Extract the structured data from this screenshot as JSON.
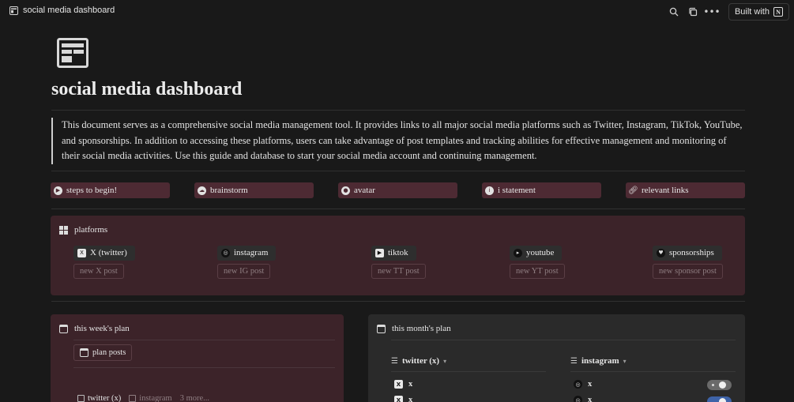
{
  "topbar": {
    "title": "social media dashboard",
    "built_label": "Built with",
    "icons": [
      "page-icon",
      "search-icon",
      "duplicate-icon",
      "more-icon"
    ]
  },
  "page": {
    "title": "social media dashboard",
    "description": "This document serves as a comprehensive social media management tool. It provides links to all major social media platforms such as Twitter, Instagram, TikTok, YouTube, and sponsorships. In addition to accessing these platforms, users can take advantage of post templates and tracking abilities for effective management and monitoring of their social media activities. Use this guide and database to start your social media account and continuing management."
  },
  "nav_buttons": [
    {
      "label": "steps to begin!",
      "icon": "play-icon"
    },
    {
      "label": "brainstorm",
      "icon": "brain-icon"
    },
    {
      "label": "avatar",
      "icon": "user-icon"
    },
    {
      "label": "i statement",
      "icon": "info-icon"
    },
    {
      "label": "relevant links",
      "icon": "link-icon"
    }
  ],
  "platforms": {
    "title": "platforms",
    "items": [
      {
        "label": "X (twitter)",
        "new_label": "new X post",
        "icon": "x-icon"
      },
      {
        "label": "instagram",
        "new_label": "new IG post",
        "icon": "instagram-icon"
      },
      {
        "label": "tiktok",
        "new_label": "new TT post",
        "icon": "tiktok-icon"
      },
      {
        "label": "youtube",
        "new_label": "new YT post",
        "icon": "youtube-icon"
      },
      {
        "label": "sponsorships",
        "new_label": "new sponsor post",
        "icon": "heart-icon"
      }
    ]
  },
  "week_plan": {
    "title": "this week's plan",
    "plan_button": "plan posts",
    "tabs": [
      "twitter (x)",
      "instagram",
      "3 more..."
    ]
  },
  "month_plan": {
    "title": "this month's plan",
    "columns": [
      {
        "label": "twitter (x)",
        "rows": [
          "x",
          "x"
        ]
      },
      {
        "label": "instagram",
        "rows": [
          "x",
          "x"
        ]
      }
    ]
  },
  "colors": {
    "background": "#191919",
    "accent_maroon": "#4d2a33",
    "panel_maroon": "#3c2329",
    "panel_gray": "#2a2a2a"
  }
}
